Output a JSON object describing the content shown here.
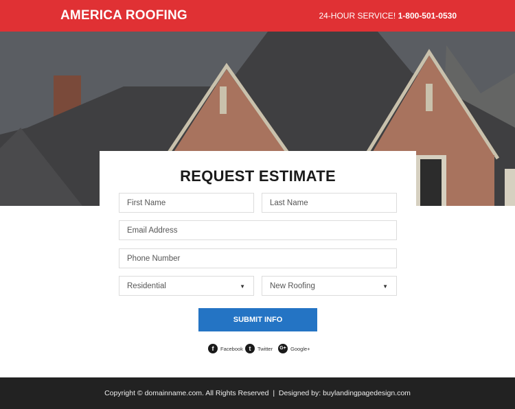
{
  "header": {
    "brand": "AMERICA ROOFING",
    "service_label": "24-HOUR SERVICE!",
    "phone": "1-800-501-0530"
  },
  "form": {
    "title": "REQUEST ESTIMATE",
    "first_name_placeholder": "First Name",
    "last_name_placeholder": "Last Name",
    "email_placeholder": "Email Address",
    "phone_placeholder": "Phone Number",
    "property_type_selected": "Residential",
    "service_type_selected": "New Roofing",
    "submit_label": "SUBMIT INFO"
  },
  "social": [
    {
      "icon": "facebook-icon",
      "glyph": "f",
      "label": "Facebook"
    },
    {
      "icon": "twitter-icon",
      "glyph": "t",
      "label": "Twitter"
    },
    {
      "icon": "google-plus-icon",
      "glyph": "G+",
      "label": "Google+"
    }
  ],
  "footer": {
    "copyright": "Copyright © domainname.com. All Rights Reserved  |  Designed by: buylandingpagedesign.com"
  },
  "colors": {
    "header_bg": "#e03134",
    "submit_bg": "#2474c4",
    "footer_bg": "#222222"
  }
}
